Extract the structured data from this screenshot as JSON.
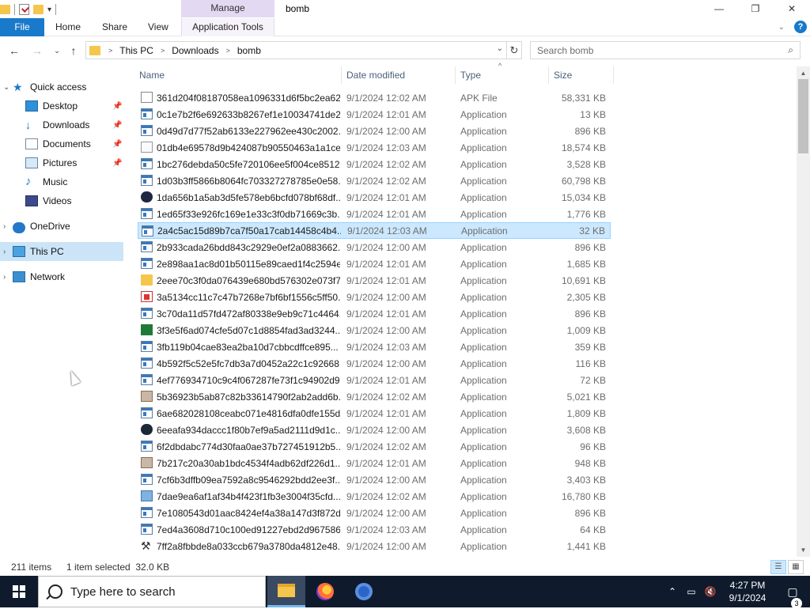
{
  "window": {
    "title": "bomb",
    "contextual_tab_group": "Manage",
    "minimize_glyph": "—",
    "maximize_glyph": "❐",
    "close_glyph": "✕"
  },
  "ribbon": {
    "tabs": [
      "File",
      "Home",
      "Share",
      "View",
      "Application Tools"
    ],
    "help": "?"
  },
  "address_bar": {
    "crumbs": [
      "This PC",
      "Downloads",
      "bomb"
    ]
  },
  "search": {
    "placeholder": "Search bomb"
  },
  "nav_pane": {
    "quick_access": "Quick access",
    "items": [
      "Desktop",
      "Downloads",
      "Documents",
      "Pictures",
      "Music",
      "Videos"
    ],
    "onedrive": "OneDrive",
    "this_pc": "This PC",
    "network": "Network"
  },
  "columns": {
    "name": "Name",
    "date": "Date modified",
    "type": "Type",
    "size": "Size"
  },
  "files": [
    {
      "name": "361d204f08187058ea1096331d6f5bc2ea62...",
      "date": "9/1/2024 12:02 AM",
      "type": "APK File",
      "size": "58,331 KB",
      "icon": "apk-file-icon"
    },
    {
      "name": "0c1e7b2f6e692633b8267ef1e10034741de2...",
      "date": "9/1/2024 12:01 AM",
      "type": "Application",
      "size": "13 KB",
      "icon": "application-icon"
    },
    {
      "name": "0d49d7d77f52ab6133e227962ee430c2002...",
      "date": "9/1/2024 12:00 AM",
      "type": "Application",
      "size": "896 KB",
      "icon": "application-icon"
    },
    {
      "name": "01db4e69578d9b424087b90550463a1a1ce...",
      "date": "9/1/2024 12:03 AM",
      "type": "Application",
      "size": "18,574 KB",
      "icon": "generic-app-icon"
    },
    {
      "name": "1bc276debda50c5fe720106ee5f004ce8512...",
      "date": "9/1/2024 12:02 AM",
      "type": "Application",
      "size": "3,528 KB",
      "icon": "application-icon"
    },
    {
      "name": "1d03b3ff5866b8064fc703327278785e0e58...",
      "date": "9/1/2024 12:02 AM",
      "type": "Application",
      "size": "60,798 KB",
      "icon": "application-icon"
    },
    {
      "name": "1da656b1a5ab3d5fe578eb6bcfd078bf68df...",
      "date": "9/1/2024 12:01 AM",
      "type": "Application",
      "size": "15,034 KB",
      "icon": "dark-app-icon"
    },
    {
      "name": "1ed65f33e926fc169e1e33c3f0db71669c3b...",
      "date": "9/1/2024 12:01 AM",
      "type": "Application",
      "size": "1,776 KB",
      "icon": "application-icon"
    },
    {
      "name": "2a4c5ac15d89b7ca7f50a17cab14458c4b4...",
      "date": "9/1/2024 12:03 AM",
      "type": "Application",
      "size": "32 KB",
      "icon": "application-icon",
      "selected": true
    },
    {
      "name": "2b933cada26bdd843c2929e0ef2a0883662...",
      "date": "9/1/2024 12:00 AM",
      "type": "Application",
      "size": "896 KB",
      "icon": "application-icon"
    },
    {
      "name": "2e898aa1ac8d01b50115e89caed1f4c2594e...",
      "date": "9/1/2024 12:01 AM",
      "type": "Application",
      "size": "1,685 KB",
      "icon": "application-icon"
    },
    {
      "name": "2eee70c3f0da076439e680bd576302e073f7...",
      "date": "9/1/2024 12:01 AM",
      "type": "Application",
      "size": "10,691 KB",
      "icon": "folder-app-icon"
    },
    {
      "name": "3a5134cc11c7c47b7268e7bf6bf1556c5ff50...",
      "date": "9/1/2024 12:00 AM",
      "type": "Application",
      "size": "2,305 KB",
      "icon": "red-app-icon"
    },
    {
      "name": "3c70da11d57fd472af80338e9eb9c71c4464...",
      "date": "9/1/2024 12:01 AM",
      "type": "Application",
      "size": "896 KB",
      "icon": "application-icon"
    },
    {
      "name": "3f3e5f6ad074cfe5d07c1d8854fad3ad3244...",
      "date": "9/1/2024 12:00 AM",
      "type": "Application",
      "size": "1,009 KB",
      "icon": "green-app-icon"
    },
    {
      "name": "3fb119b04cae83ea2ba10d7cbbcdffce895...",
      "date": "9/1/2024 12:03 AM",
      "type": "Application",
      "size": "359 KB",
      "icon": "application-icon"
    },
    {
      "name": "4b592f5c52e5fc7db3a7d0452a22c1c92668...",
      "date": "9/1/2024 12:00 AM",
      "type": "Application",
      "size": "116 KB",
      "icon": "application-icon"
    },
    {
      "name": "4ef776934710c9c4f067287fe73f1c94902d9...",
      "date": "9/1/2024 12:01 AM",
      "type": "Application",
      "size": "72 KB",
      "icon": "application-icon"
    },
    {
      "name": "5b36923b5ab87c82b33614790f2ab2add6b...",
      "date": "9/1/2024 12:02 AM",
      "type": "Application",
      "size": "5,021 KB",
      "icon": "mixed-app-icon"
    },
    {
      "name": "6ae682028108ceabc071e4816dfa0dfe155d...",
      "date": "9/1/2024 12:01 AM",
      "type": "Application",
      "size": "1,809 KB",
      "icon": "application-icon"
    },
    {
      "name": "6eeafa934daccc1f80b7ef9a5ad2111d9d1c...",
      "date": "9/1/2024 12:00 AM",
      "type": "Application",
      "size": "3,608 KB",
      "icon": "steam-icon"
    },
    {
      "name": "6f2dbdabc774d30faa0ae37b727451912b5...",
      "date": "9/1/2024 12:02 AM",
      "type": "Application",
      "size": "96 KB",
      "icon": "application-icon"
    },
    {
      "name": "7b217c20a30ab1bdc4534f4adb62df226d1...",
      "date": "9/1/2024 12:01 AM",
      "type": "Application",
      "size": "948 KB",
      "icon": "mixed-app-icon"
    },
    {
      "name": "7cf6b3dffb09ea7592a8c9546292bdd2ee3f...",
      "date": "9/1/2024 12:00 AM",
      "type": "Application",
      "size": "3,403 KB",
      "icon": "application-icon"
    },
    {
      "name": "7dae9ea6af1af34b4f423f1fb3e3004f35cfd...",
      "date": "9/1/2024 12:02 AM",
      "type": "Application",
      "size": "16,780 KB",
      "icon": "blue-app-icon"
    },
    {
      "name": "7e1080543d01aac8424ef4a38a147d3f872d...",
      "date": "9/1/2024 12:00 AM",
      "type": "Application",
      "size": "896 KB",
      "icon": "application-icon"
    },
    {
      "name": "7ed4a3608d710c100ed91227ebd2d967586...",
      "date": "9/1/2024 12:03 AM",
      "type": "Application",
      "size": "64 KB",
      "icon": "application-icon"
    },
    {
      "name": "7ff2a8fbbde8a033ccb679a3780da4812e48...",
      "date": "9/1/2024 12:00 AM",
      "type": "Application",
      "size": "1,441 KB",
      "icon": "tools-icon"
    }
  ],
  "status_bar": {
    "item_count": "211 items",
    "selection": "1 item selected  32.0 KB"
  },
  "taskbar": {
    "search_placeholder": "Type here to search",
    "time": "4:27 PM",
    "date": "9/1/2024",
    "notification_count": "3"
  },
  "colors": {
    "accent": "#1979ca",
    "selection": "#cce8ff",
    "taskbar": "#0f1b2d",
    "manage_tab": "#e4d9f2"
  }
}
